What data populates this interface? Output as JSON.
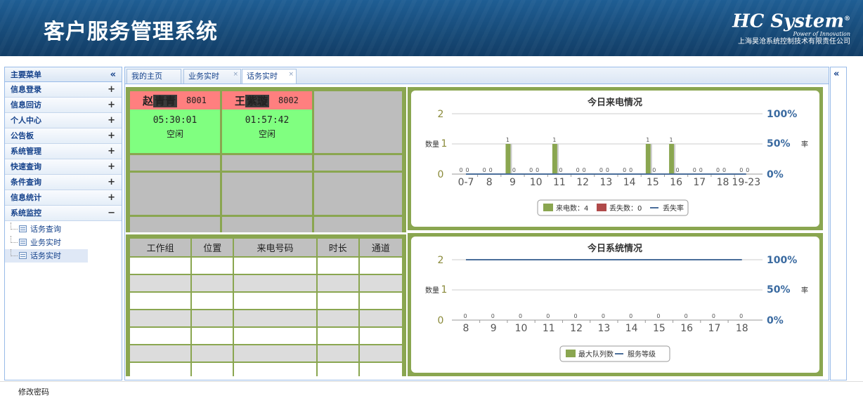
{
  "header": {
    "title": "客户服务管理系统",
    "logo_main": "HC System",
    "logo_reg": "®",
    "logo_tagline": "Power of Innovation",
    "logo_company": "上海昊沧系统控制技术有限责任公司"
  },
  "sidebar": {
    "title": "主要菜单",
    "collapse_icon": "«",
    "items": [
      {
        "label": "信息登录",
        "toggle": "+"
      },
      {
        "label": "信息回访",
        "toggle": "+"
      },
      {
        "label": "个人中心",
        "toggle": "+"
      },
      {
        "label": "公告板",
        "toggle": "+"
      },
      {
        "label": "系统管理",
        "toggle": "+"
      },
      {
        "label": "快速查询",
        "toggle": "+"
      },
      {
        "label": "条件查询",
        "toggle": "+"
      },
      {
        "label": "信息统计",
        "toggle": "+"
      },
      {
        "label": "系统监控",
        "toggle": "−"
      }
    ],
    "sub_items": [
      {
        "label": "话务查询"
      },
      {
        "label": "业务实时"
      },
      {
        "label": "话务实时"
      }
    ]
  },
  "tabs": [
    {
      "label": "我的主页",
      "closable": false
    },
    {
      "label": "业务实时",
      "closable": true
    },
    {
      "label": "话务实时",
      "closable": true,
      "active": true
    }
  ],
  "tab_close": "×",
  "right_collapse": "«",
  "agents": [
    {
      "name_pre": "赵",
      "name_hl": "青青",
      "ext": "8001",
      "time": "05:30:01",
      "status": "空闲"
    },
    {
      "name_pre": "王",
      "name_hl": "紫璇",
      "ext": "8002",
      "time": "01:57:42",
      "status": "空闲"
    }
  ],
  "call_table": {
    "headers": [
      "工作组",
      "位置",
      "来电号码",
      "时长",
      "通道"
    ]
  },
  "chart_data": [
    {
      "type": "bar",
      "title": "今日来电情况",
      "ylabel": "数量",
      "y2label": "率",
      "ylim": [
        0,
        2
      ],
      "yticks": [
        "0",
        "1",
        "2"
      ],
      "y2ticks": [
        "0%",
        "50%",
        "100%"
      ],
      "categories": [
        "0-7",
        "8",
        "9",
        "10",
        "11",
        "12",
        "13",
        "14",
        "15",
        "16",
        "17",
        "18",
        "19-23"
      ],
      "series": [
        {
          "name": "来电数",
          "color": "#8aa650",
          "values": [
            0,
            0,
            1,
            0,
            1,
            0,
            0,
            0,
            1,
            1,
            0,
            0,
            0
          ]
        },
        {
          "name": "丢失数",
          "color": "#b04a4a",
          "values": [
            0,
            0,
            0,
            0,
            0,
            0,
            0,
            0,
            0,
            0,
            0,
            0,
            0
          ]
        },
        {
          "name": "丢失率",
          "color": "#4a6e9a",
          "values": [
            0,
            0,
            0,
            0,
            0,
            0,
            0,
            0,
            0,
            0,
            0,
            0,
            0
          ]
        }
      ],
      "legend": [
        "来电数：4",
        "丢失数：0",
        "丢失率"
      ]
    },
    {
      "type": "bar",
      "title": "今日系统情况",
      "ylabel": "数量",
      "y2label": "率",
      "ylim": [
        0,
        2
      ],
      "yticks": [
        "0",
        "1",
        "2"
      ],
      "y2ticks": [
        "0%",
        "50%",
        "100%"
      ],
      "categories": [
        "8",
        "9",
        "10",
        "11",
        "12",
        "13",
        "14",
        "15",
        "16",
        "17",
        "18"
      ],
      "series": [
        {
          "name": "最大队列数",
          "color": "#8aa650",
          "values": [
            0,
            0,
            0,
            0,
            0,
            0,
            0,
            0,
            0,
            0,
            0
          ]
        },
        {
          "name": "服务等级",
          "color": "#4a6e9a",
          "values": [
            100,
            100,
            100,
            100,
            100,
            100,
            100,
            100,
            100,
            100,
            100
          ]
        }
      ],
      "legend": [
        "最大队列数",
        "服务等级"
      ]
    }
  ],
  "footer": {
    "change_password": "修改密码"
  }
}
